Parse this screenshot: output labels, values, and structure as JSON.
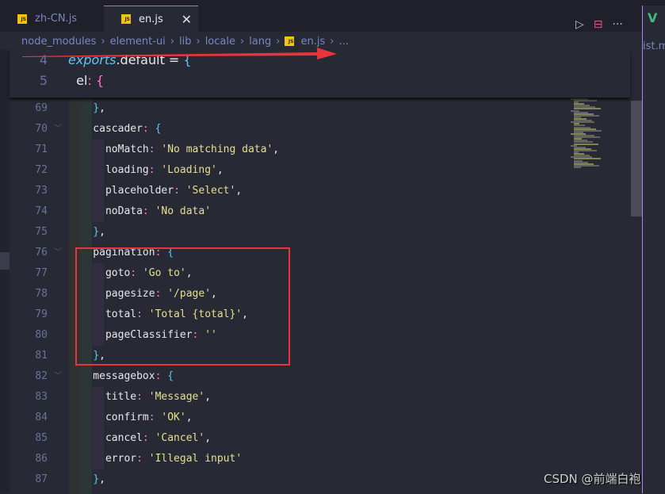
{
  "tabs": [
    {
      "label": "zh-CN.js",
      "icon": "js-file-icon",
      "active": false
    },
    {
      "label": "en.js",
      "icon": "js-file-icon",
      "active": true
    }
  ],
  "tab_icon_text": "JS",
  "close_glyph": "✕",
  "actions": {
    "run": "▷",
    "split": "⊟",
    "more": "···"
  },
  "breadcrumb": [
    "node_modules",
    "element-ui",
    "lib",
    "locale",
    "lang",
    "en.js",
    "..."
  ],
  "sticky": [
    {
      "n": "4",
      "tokens": [
        [
          "it",
          "exports"
        ],
        [
          "k",
          ".default = "
        ],
        [
          "b",
          "{"
        ]
      ]
    },
    {
      "n": "5",
      "tokens": [
        [
          "k",
          "  el"
        ],
        [
          "p",
          ": "
        ],
        [
          "p",
          "{"
        ]
      ]
    }
  ],
  "lines": [
    {
      "n": "69",
      "tokens": [
        [
          "k",
          "    "
        ],
        [
          "b",
          "}"
        ],
        [
          "k",
          ","
        ]
      ]
    },
    {
      "n": "70",
      "fold": true,
      "tokens": [
        [
          "k",
          "    cascader"
        ],
        [
          "p",
          ": "
        ],
        [
          "b",
          "{"
        ]
      ]
    },
    {
      "n": "71",
      "tokens": [
        [
          "k",
          "      noMatch"
        ],
        [
          "p",
          ": "
        ],
        [
          "s",
          "'No matching data'"
        ],
        [
          "k",
          ","
        ]
      ]
    },
    {
      "n": "72",
      "tokens": [
        [
          "k",
          "      loading"
        ],
        [
          "p",
          ": "
        ],
        [
          "s",
          "'Loading'"
        ],
        [
          "k",
          ","
        ]
      ]
    },
    {
      "n": "73",
      "tokens": [
        [
          "k",
          "      placeholder"
        ],
        [
          "p",
          ": "
        ],
        [
          "s",
          "'Select'"
        ],
        [
          "k",
          ","
        ]
      ]
    },
    {
      "n": "74",
      "tokens": [
        [
          "k",
          "      noData"
        ],
        [
          "p",
          ": "
        ],
        [
          "s",
          "'No data'"
        ]
      ]
    },
    {
      "n": "75",
      "tokens": [
        [
          "k",
          "    "
        ],
        [
          "b",
          "}"
        ],
        [
          "k",
          ","
        ]
      ]
    },
    {
      "n": "76",
      "fold": true,
      "tokens": [
        [
          "k",
          "    pagination"
        ],
        [
          "p",
          ": "
        ],
        [
          "b",
          "{"
        ]
      ]
    },
    {
      "n": "77",
      "tokens": [
        [
          "k",
          "      goto"
        ],
        [
          "p",
          ": "
        ],
        [
          "s",
          "'Go to'"
        ],
        [
          "k",
          ","
        ]
      ]
    },
    {
      "n": "78",
      "tokens": [
        [
          "k",
          "      pagesize"
        ],
        [
          "p",
          ": "
        ],
        [
          "s",
          "'/page'"
        ],
        [
          "k",
          ","
        ]
      ]
    },
    {
      "n": "79",
      "tokens": [
        [
          "k",
          "      total"
        ],
        [
          "p",
          ": "
        ],
        [
          "s",
          "'Total {total}'"
        ],
        [
          "k",
          ","
        ]
      ]
    },
    {
      "n": "80",
      "tokens": [
        [
          "k",
          "      pageClassifier"
        ],
        [
          "p",
          ": "
        ],
        [
          "s",
          "''"
        ]
      ]
    },
    {
      "n": "81",
      "tokens": [
        [
          "k",
          "    "
        ],
        [
          "b",
          "}"
        ],
        [
          "k",
          ","
        ]
      ]
    },
    {
      "n": "82",
      "fold": true,
      "tokens": [
        [
          "k",
          "    messagebox"
        ],
        [
          "p",
          ": "
        ],
        [
          "b",
          "{"
        ]
      ]
    },
    {
      "n": "83",
      "tokens": [
        [
          "k",
          "      title"
        ],
        [
          "p",
          ": "
        ],
        [
          "s",
          "'Message'"
        ],
        [
          "k",
          ","
        ]
      ]
    },
    {
      "n": "84",
      "tokens": [
        [
          "k",
          "      confirm"
        ],
        [
          "p",
          ": "
        ],
        [
          "s",
          "'OK'"
        ],
        [
          "k",
          ","
        ]
      ]
    },
    {
      "n": "85",
      "tokens": [
        [
          "k",
          "      cancel"
        ],
        [
          "p",
          ": "
        ],
        [
          "s",
          "'Cancel'"
        ],
        [
          "k",
          ","
        ]
      ]
    },
    {
      "n": "86",
      "tokens": [
        [
          "k",
          "      error"
        ],
        [
          "p",
          ": "
        ],
        [
          "s",
          "'Illegal input'"
        ]
      ]
    },
    {
      "n": "87",
      "tokens": [
        [
          "k",
          "    "
        ],
        [
          "b",
          "}"
        ],
        [
          "k",
          ","
        ]
      ]
    }
  ],
  "second_pane": {
    "icon": "vue-icon",
    "glyph": "V",
    "label": "ist.m..."
  },
  "watermark": "CSDN @前端白袍",
  "colors": {
    "annotation": "#e8343a",
    "accent": "#b67ef0",
    "string": "#e6e08c",
    "punct": "#ff79c6",
    "brace": "#5fc8f0"
  }
}
